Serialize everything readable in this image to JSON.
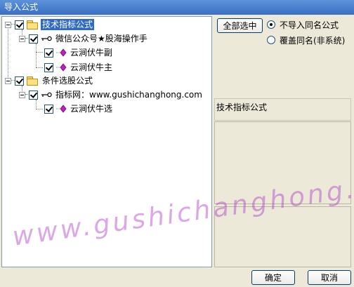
{
  "window": {
    "title": "导入公式"
  },
  "tree": {
    "nodes": [
      {
        "label": "技术指标公式",
        "type": "folder",
        "checked": true,
        "selected": true
      },
      {
        "label": "微信公众号★股海操作手",
        "type": "key",
        "checked": true
      },
      {
        "label": "云涧伏牛副",
        "type": "formula",
        "checked": true
      },
      {
        "label": "云涧伏牛主",
        "type": "formula",
        "checked": true
      },
      {
        "label": "条件选股公式",
        "type": "folder",
        "checked": true
      },
      {
        "label": "指标网：www.gushichanghong.com",
        "type": "key",
        "checked": true
      },
      {
        "label": "云涧伏牛选",
        "type": "formula",
        "checked": true
      }
    ]
  },
  "options": {
    "select_all_label": "全部选中",
    "radio_no_import": "不导入同名公式",
    "radio_overwrite": "覆盖同名(非系统)",
    "selected_option": "不导入同名公式"
  },
  "info": {
    "name": "技术指标公式"
  },
  "footer": {
    "ok_label": "确定",
    "cancel_label": "取消"
  },
  "watermark": {
    "text": "www.gushichanghong.com"
  },
  "colors": {
    "selection": "#316ac5",
    "title_bar": "#3a6fc4",
    "watermark": "#b03cc8",
    "formula_icon": "#c020c0"
  }
}
